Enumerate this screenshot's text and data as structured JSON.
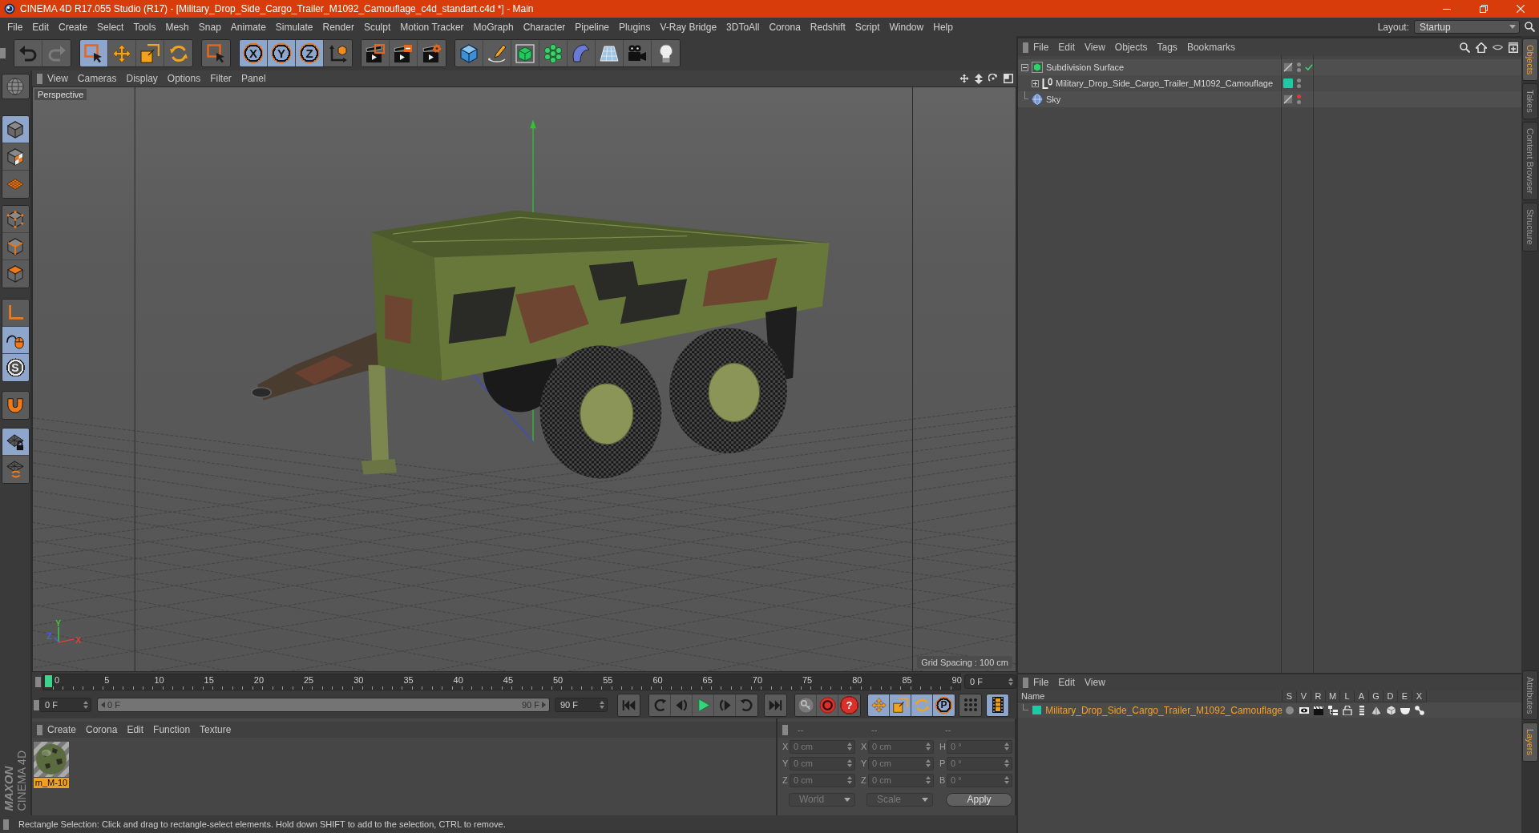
{
  "window": {
    "title": "CINEMA 4D R17.055 Studio (R17) - [Military_Drop_Side_Cargo_Trailer_M1092_Camouflage_c4d_standart.c4d *] - Main"
  },
  "menu_bar": {
    "items": [
      "File",
      "Edit",
      "Create",
      "Select",
      "Tools",
      "Mesh",
      "Snap",
      "Animate",
      "Simulate",
      "Render",
      "Sculpt",
      "Motion Tracker",
      "MoGraph",
      "Character",
      "Pipeline",
      "Plugins",
      "V-Ray Bridge",
      "3DToAll",
      "Corona",
      "Redshift",
      "Script",
      "Window",
      "Help"
    ],
    "layout_label": "Layout:",
    "layout_value": "Startup"
  },
  "toolbar": [
    [
      {
        "kind": "undo",
        "disabled": false
      },
      {
        "kind": "redo",
        "disabled": true
      }
    ],
    [
      {
        "kind": "select",
        "selected": true
      },
      {
        "kind": "move",
        "selected": false
      },
      {
        "kind": "scale",
        "selected": false
      },
      {
        "kind": "rotate",
        "selected": false
      }
    ],
    [
      {
        "kind": "select",
        "selected": false
      }
    ],
    [
      {
        "kind": "axis",
        "label": "X",
        "selected": true
      },
      {
        "kind": "axis",
        "label": "Y",
        "selected": true
      },
      {
        "kind": "axis",
        "label": "Z",
        "selected": true
      },
      {
        "kind": "coordinates",
        "selected": false
      }
    ],
    [
      {
        "kind": "render-view"
      },
      {
        "kind": "render-picture"
      },
      {
        "kind": "render-settings"
      }
    ],
    [
      {
        "kind": "cube"
      },
      {
        "kind": "pen"
      },
      {
        "kind": "subdivision"
      },
      {
        "kind": "cloner"
      },
      {
        "kind": "deformer"
      },
      {
        "kind": "floor"
      },
      {
        "kind": "camera"
      },
      {
        "kind": "light"
      }
    ]
  ],
  "palette": [
    [
      {
        "kind": "globe",
        "selected": false
      }
    ],
    [
      {
        "kind": "model",
        "selected": true
      },
      {
        "kind": "texture",
        "selected": false
      },
      {
        "kind": "workplane",
        "selected": false
      }
    ],
    [
      {
        "kind": "points",
        "selected": false
      },
      {
        "kind": "edges",
        "selected": false
      },
      {
        "kind": "polygons",
        "selected": false
      }
    ],
    [
      {
        "kind": "axis",
        "selected": false
      },
      {
        "kind": "tweak",
        "selected": true
      },
      {
        "kind": "snap",
        "label": "S",
        "selected": true
      }
    ],
    [
      {
        "kind": "magnet",
        "selected": false
      }
    ],
    [
      {
        "kind": "lock-workplane",
        "selected": true
      },
      {
        "kind": "planar-workplane",
        "selected": false
      }
    ]
  ],
  "logo": {
    "brand": "MAXON",
    "product": "CINEMA 4D"
  },
  "viewport": {
    "menu": [
      "View",
      "Cameras",
      "Display",
      "Options",
      "Filter",
      "Panel"
    ],
    "camera": "Perspective",
    "grid_spacing": "Grid Spacing : 100 cm",
    "axis_gizmo": [
      {
        "label": "Y",
        "color": "#3fc43f"
      },
      {
        "label": "Z",
        "color": "#4a5ee8"
      },
      {
        "label": "X",
        "color": "#e0403a"
      }
    ]
  },
  "timeline": {
    "ticks": [
      "0",
      "5",
      "10",
      "15",
      "20",
      "25",
      "30",
      "35",
      "40",
      "45",
      "50",
      "55",
      "60",
      "65",
      "70",
      "75",
      "80",
      "85",
      "90"
    ],
    "level": 0,
    "current_frame": "0 F",
    "start_field": "0 F",
    "range": {
      "start": "0 F",
      "end": "90 F",
      "level": 1
    },
    "end_field": "90 F"
  },
  "transport": {
    "playback": [
      [
        {
          "kind": "go-start"
        }
      ],
      [
        {
          "kind": "prev-key"
        },
        {
          "kind": "prev-frame"
        },
        {
          "kind": "play"
        },
        {
          "kind": "next-frame"
        },
        {
          "kind": "next-key"
        }
      ],
      [
        {
          "kind": "go-end"
        }
      ]
    ],
    "record": [
      {
        "kind": "key"
      },
      {
        "kind": "autokey"
      },
      {
        "kind": "keyframe-selection",
        "label": "?"
      }
    ],
    "key_tracks": [
      {
        "kind": "move",
        "selected": true
      },
      {
        "kind": "scale",
        "selected": true
      },
      {
        "kind": "rotate",
        "selected": true
      },
      {
        "kind": "parameter",
        "label": "P",
        "selected": true
      }
    ],
    "point_level": {
      "selected": false
    },
    "timeline_button": {
      "selected": true
    }
  },
  "material_manager": {
    "menu": [
      "Create",
      "Corona",
      "Edit",
      "Function",
      "Texture"
    ],
    "materials": [
      {
        "name": "m_M-10",
        "selected": true
      }
    ]
  },
  "coordinates": {
    "headers": [
      "--",
      "--",
      "--"
    ],
    "rows": [
      {
        "cells": [
          {
            "axis": "X",
            "value": "0 cm"
          },
          {
            "axis": "X",
            "value": "0 cm"
          },
          {
            "axis": "H",
            "value": "0 °"
          }
        ]
      },
      {
        "cells": [
          {
            "axis": "Y",
            "value": "0 cm"
          },
          {
            "axis": "Y",
            "value": "0 cm"
          },
          {
            "axis": "P",
            "value": "0 °"
          }
        ]
      },
      {
        "cells": [
          {
            "axis": "Z",
            "value": "0 cm"
          },
          {
            "axis": "Z",
            "value": "0 cm"
          },
          {
            "axis": "B",
            "value": "0 °"
          }
        ]
      }
    ],
    "dropdowns": [
      "World",
      "Scale"
    ],
    "apply": "Apply"
  },
  "object_manager": {
    "menu": [
      "File",
      "Edit",
      "View",
      "Objects",
      "Tags",
      "Bookmarks"
    ],
    "objects": [
      {
        "name": "Subdivision Surface",
        "kind": "subdivision",
        "selected": false,
        "expanded": true,
        "enabled": true,
        "editor_hidden": false,
        "children": [
          {
            "name": "Military_Drop_Side_Cargo_Trailer_M1092_Camouflage",
            "kind": "null",
            "selected": false,
            "expanded": false,
            "color": "#1ec9a5",
            "editor_hidden": false
          }
        ]
      },
      {
        "name": "Sky",
        "kind": "sky",
        "selected": false,
        "editor_hidden": true
      }
    ]
  },
  "layer_manager": {
    "menu": [
      "File",
      "Edit",
      "View"
    ],
    "columns": [
      "Name",
      "S",
      "V",
      "R",
      "M",
      "L",
      "A",
      "G",
      "D",
      "E",
      "X"
    ],
    "layers": [
      {
        "name": "Military_Drop_Side_Cargo_Trailer_M1092_Camouflage",
        "color": "#1ec9a5",
        "selected": true
      }
    ]
  },
  "side_tabs": {
    "top": [
      {
        "label": "Objects",
        "selected": true
      },
      {
        "label": "Takes",
        "selected": false
      },
      {
        "label": "Content Browser",
        "selected": false
      },
      {
        "label": "Structure",
        "selected": false
      }
    ],
    "bottom": [
      {
        "label": "Attributes",
        "selected": false
      },
      {
        "label": "Layers",
        "selected": true
      }
    ]
  },
  "status_bar": {
    "text": "Rectangle Selection: Click and drag to rectangle-select elements. Hold down SHIFT to add to the selection, CTRL to remove."
  }
}
